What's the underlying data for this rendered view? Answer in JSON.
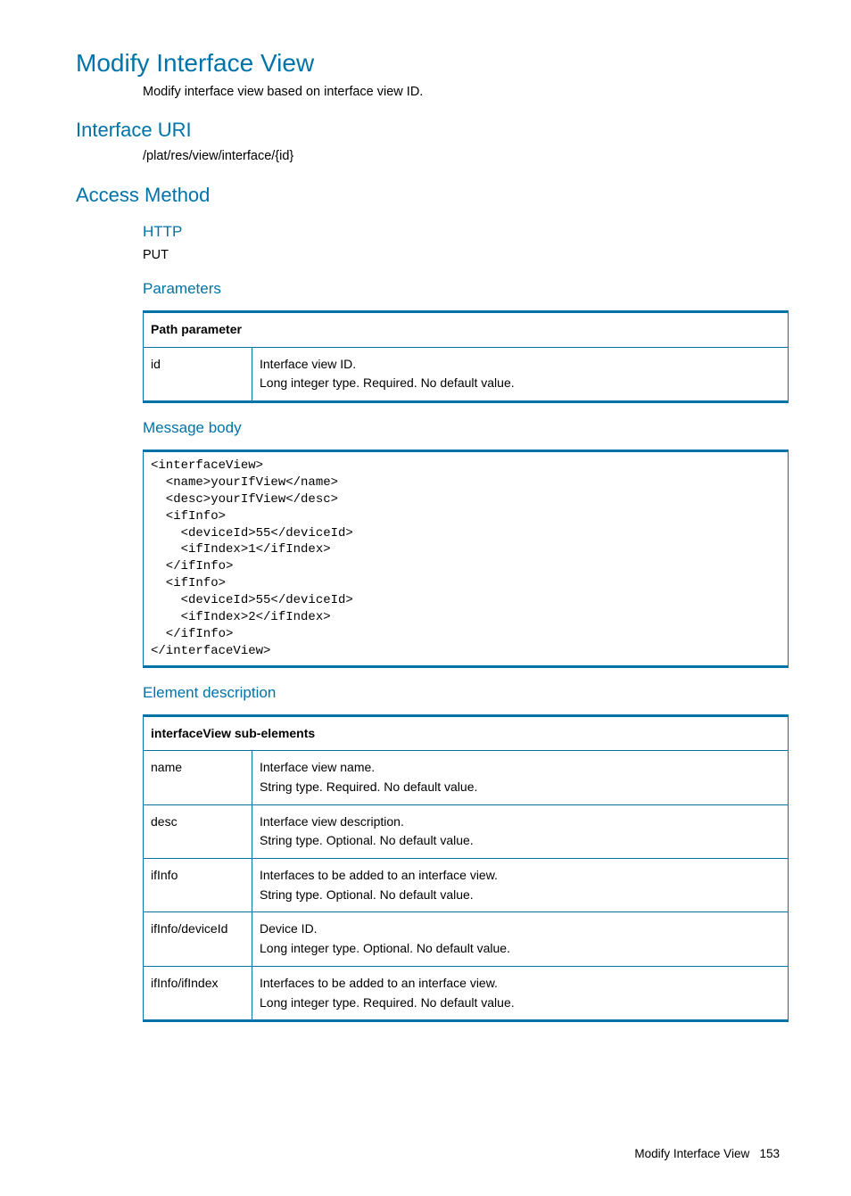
{
  "page": {
    "title": "Modify Interface View",
    "intro": "Modify interface view based on interface view ID."
  },
  "uri": {
    "heading": "Interface URI",
    "path": "/plat/res/view/interface/{id}"
  },
  "access": {
    "heading": "Access Method",
    "http_heading": "HTTP",
    "http_method": "PUT",
    "parameters_heading": "Parameters",
    "path_param_table": {
      "header": "Path parameter",
      "rows": [
        {
          "name": "id",
          "desc_line1": "Interface view ID.",
          "desc_line2": "Long integer type. Required. No default value."
        }
      ]
    },
    "message_body_heading": "Message body",
    "message_body_code": "<interfaceView>\n  <name>yourIfView</name>\n  <desc>yourIfView</desc>\n  <ifInfo>\n    <deviceId>55</deviceId>\n    <ifIndex>1</ifIndex>\n  </ifInfo>\n  <ifInfo>\n    <deviceId>55</deviceId>\n    <ifIndex>2</ifIndex>\n  </ifInfo>\n</interfaceView>",
    "element_desc_heading": "Element description",
    "element_table": {
      "header": "interfaceView sub-elements",
      "rows": [
        {
          "name": "name",
          "d1": "Interface view name.",
          "d2": "String type. Required. No default value."
        },
        {
          "name": "desc",
          "d1": "Interface view description.",
          "d2": "String type. Optional. No default value."
        },
        {
          "name": "ifInfo",
          "d1": "Interfaces to be added to an interface view.",
          "d2": "String type. Optional. No default value."
        },
        {
          "name": "ifInfo/deviceId",
          "d1": "Device ID.",
          "d2": "Long integer type. Optional. No default value."
        },
        {
          "name": "ifInfo/ifIndex",
          "d1": "Interfaces to be added to an interface view.",
          "d2": "Long integer type. Required. No default value."
        }
      ]
    }
  },
  "footer": {
    "text": "Modify Interface View",
    "page_num": "153"
  }
}
